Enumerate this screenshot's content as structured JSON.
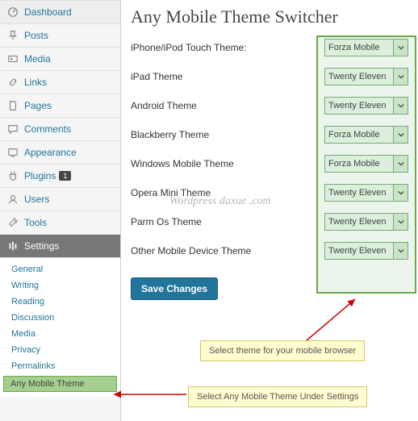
{
  "sidebar": {
    "items": [
      {
        "label": "Dashboard",
        "icon": "dashboard-icon"
      },
      {
        "label": "Posts",
        "icon": "pin-icon"
      },
      {
        "label": "Media",
        "icon": "media-icon"
      },
      {
        "label": "Links",
        "icon": "link-icon"
      },
      {
        "label": "Pages",
        "icon": "page-icon"
      },
      {
        "label": "Comments",
        "icon": "comment-icon"
      },
      {
        "label": "Appearance",
        "icon": "appearance-icon"
      },
      {
        "label": "Plugins",
        "icon": "plugin-icon",
        "badge": "1"
      },
      {
        "label": "Users",
        "icon": "users-icon"
      },
      {
        "label": "Tools",
        "icon": "tools-icon"
      },
      {
        "label": "Settings",
        "icon": "settings-icon"
      }
    ],
    "submenu": [
      {
        "label": "General"
      },
      {
        "label": "Writing"
      },
      {
        "label": "Reading"
      },
      {
        "label": "Discussion"
      },
      {
        "label": "Media"
      },
      {
        "label": "Privacy"
      },
      {
        "label": "Permalinks"
      },
      {
        "label": "Any Mobile Theme",
        "highlight": true
      }
    ]
  },
  "page": {
    "title": "Any Mobile Theme Switcher",
    "rows": [
      {
        "label": "iPhone/iPod Touch Theme:",
        "value": "Forza Mobile"
      },
      {
        "label": "iPad Theme",
        "value": "Twenty Eleven"
      },
      {
        "label": "Android Theme",
        "value": "Twenty Eleven"
      },
      {
        "label": "Blackberry Theme",
        "value": "Forza Mobile"
      },
      {
        "label": "Windows Mobile Theme",
        "value": "Forza Mobile"
      },
      {
        "label": "Opera Mini Theme",
        "value": "Twenty Eleven"
      },
      {
        "label": "Parm Os Theme",
        "value": "Twenty Eleven"
      },
      {
        "label": "Other Mobile Device Theme",
        "value": "Twenty Eleven"
      }
    ],
    "save_label": "Save Changes"
  },
  "callouts": {
    "theme_select": "Select theme for your mobile browser",
    "menu_pointer": "Select Any Mobile Theme Under Settings"
  },
  "watermark": "Wordpress daxue .com",
  "colors": {
    "accent": "#21759b",
    "highlight_border": "#6aa84f"
  }
}
